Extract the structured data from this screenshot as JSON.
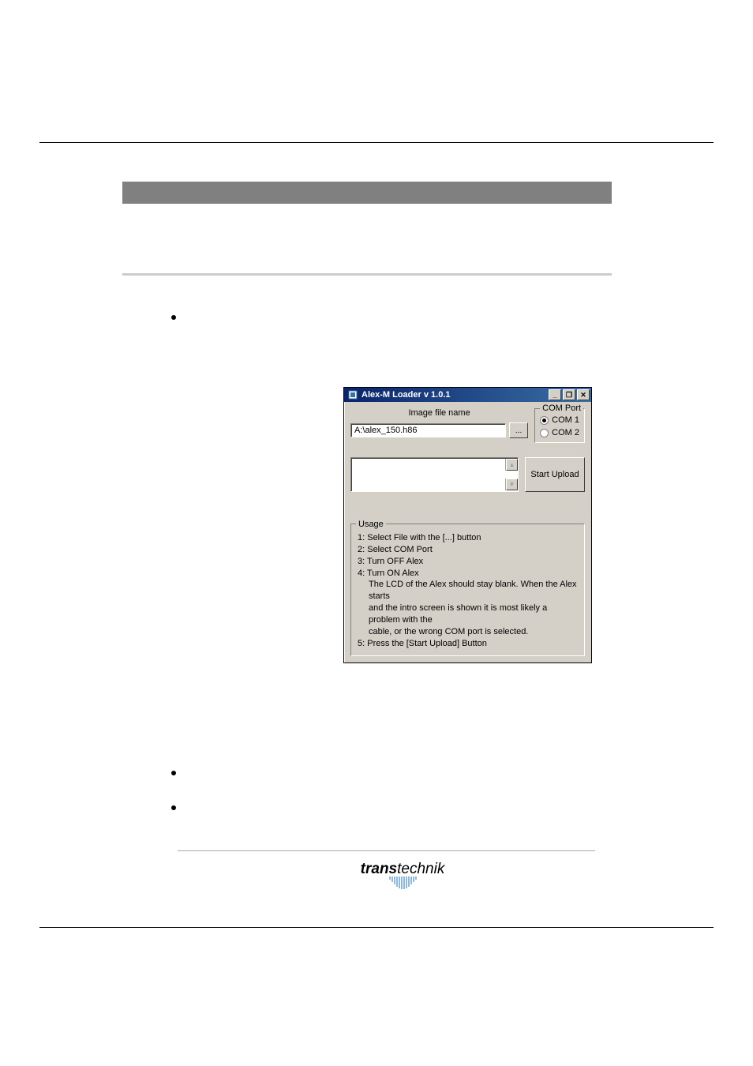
{
  "window": {
    "title": "Alex-M Loader v 1.0.1",
    "minimize_icon": "_",
    "maximize_icon": "❐",
    "close_icon": "✕",
    "image_file_label": "Image file name",
    "image_file_value": "A:\\alex_150.h86",
    "browse_label": "...",
    "com_port_label": "COM Port",
    "com1_label": "COM 1",
    "com2_label": "COM 2",
    "com_selected": "COM 1",
    "start_upload_label": "Start Upload",
    "usage_legend": "Usage",
    "usage_lines": [
      "1: Select File with the [...] button",
      "2: Select COM Port",
      "3: Turn OFF Alex",
      "4: Turn ON Alex"
    ],
    "usage_indent_lines": [
      "The LCD of the Alex should stay blank. When the Alex starts",
      "and the intro screen is shown it is most likely a problem with the",
      "cable, or the wrong COM port is selected."
    ],
    "usage_last": "5: Press the [Start Upload] Button"
  },
  "logo": {
    "bold": "trans",
    "light": "technik"
  }
}
